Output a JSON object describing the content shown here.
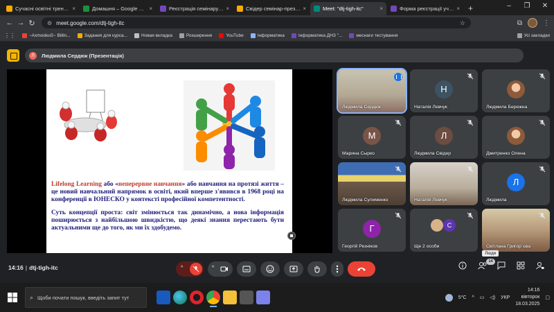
{
  "browser": {
    "tabs": [
      {
        "label": "Сучасні освітні тренди ст",
        "favicon": "#f9ab00",
        "active": false
      },
      {
        "label": "Домашня – Google Диск",
        "favicon": "#1e8e3e",
        "active": false
      },
      {
        "label": "Реєстрація семінару мат",
        "favicon": "#7248b9",
        "active": false
      },
      {
        "label": "Свідер семінар-презентат",
        "favicon": "#f9ab00",
        "active": false
      },
      {
        "label": "Meet: \"dtj-tigh-itc\"",
        "favicon": "#00897b",
        "active": true
      },
      {
        "label": "Форма реєстрації учасн",
        "favicon": "#7248b9",
        "active": false
      }
    ],
    "url": "meet.google.com/dtj-tigh-itc",
    "bookmarks": [
      {
        "label": "~Axmodeu5~ Billin...",
        "color": "#ea4335"
      },
      {
        "label": "Задания для курса...",
        "color": "#f9ab00"
      },
      {
        "label": "Новая вкладка",
        "color": "#bdc1c6"
      },
      {
        "label": "Розширення",
        "color": "#9aa0a6"
      },
      {
        "label": "YouTube",
        "color": "#ff0000"
      },
      {
        "label": "Інформатика",
        "color": "#8ab4f8"
      },
      {
        "label": "Інформатика ДНЗ \"...",
        "color": "#7248b9"
      },
      {
        "label": "меснаги тестування",
        "color": "#7248b9"
      }
    ],
    "all_bookmarks": "Усі закладки"
  },
  "meet": {
    "presenter_initial": "Л",
    "presenter_label": "Людмила Сердюк (Презентація)",
    "slide": {
      "p1_red": "Lifelong Learning",
      "p1_a": " або «",
      "p1_red2": "неперервне навчання",
      "p1_b": "» або навчання на протязі життя – це новий навчальний напрямок в освіті, який вперше з'явився в 1968 році на конференції в ЮНЕСКО у контексті професійної компетентності.",
      "p2": "Суть концепції проста: світ змінюється так динамічно, а нова інформація поширюється з найбільшою швидкістю, що деякі знання перестають бути актуальними ще до того, як ми їх здобудемо."
    },
    "participants": [
      {
        "name": "Людмила Сердюк",
        "type": "video",
        "speaking": true
      },
      {
        "name": "Наталія Левчук",
        "type": "avatar",
        "initial": "Н",
        "color": "#3c5363"
      },
      {
        "name": "Людмила Бережна",
        "type": "photo"
      },
      {
        "name": "Марина Сырко",
        "type": "avatar",
        "initial": "М",
        "color": "#795548"
      },
      {
        "name": "Людмила Свідер",
        "type": "avatar",
        "initial": "Л",
        "color": "#6d4c41"
      },
      {
        "name": "Дмитренко Олена",
        "type": "photo"
      },
      {
        "name": "Людмила Сулименко",
        "type": "video"
      },
      {
        "name": "Наталія Левчук",
        "type": "video"
      },
      {
        "name": "Людмила",
        "type": "avatar",
        "initial": "Л",
        "color": "#1a73e8"
      },
      {
        "name": "Георгій Резніков",
        "type": "avatar",
        "initial": "Г",
        "color": "#8e24aa"
      },
      {
        "name": "Ще 2 особи",
        "type": "group",
        "initial": "С"
      },
      {
        "name": "Світлана Григор`єва",
        "type": "video"
      }
    ],
    "time": "14:16",
    "meeting_code": "dtj-tigh-itc",
    "people_tooltip": "Люди",
    "people_count": "14"
  },
  "taskbar": {
    "search_placeholder": "Щоби почати пошук, введіть запит тут",
    "weather": "5°C",
    "lang": "УКР",
    "time": "14:16",
    "day": "вівторок",
    "date": "18.03.2025"
  }
}
